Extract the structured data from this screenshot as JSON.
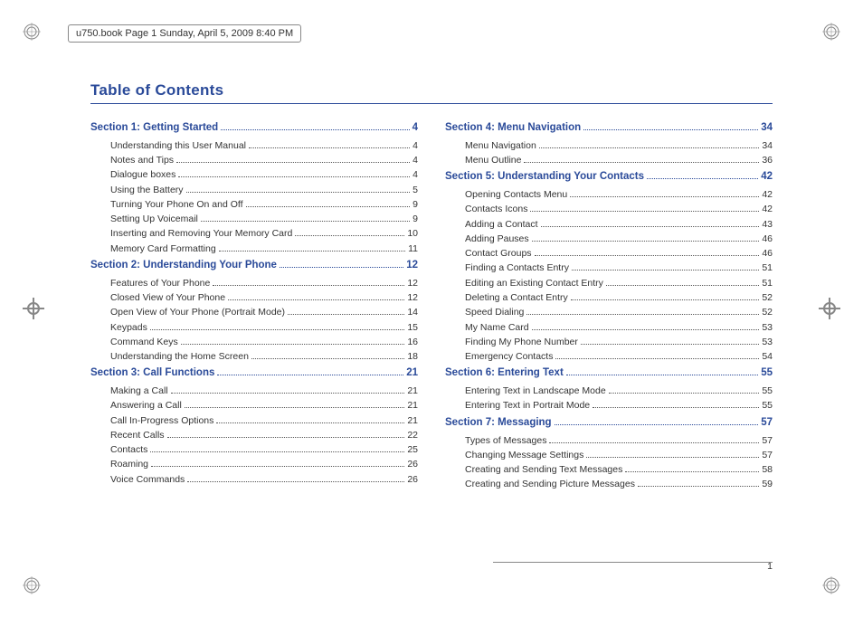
{
  "header": "u750.book  Page 1  Sunday, April 5, 2009  8:40 PM",
  "title": "Table of Contents",
  "page_number": "1",
  "left_column": [
    {
      "type": "section",
      "label": "Section 1:  Getting Started",
      "page": "4"
    },
    {
      "type": "entry",
      "label": "Understanding this User Manual",
      "page": "4"
    },
    {
      "type": "entry",
      "label": "Notes and Tips",
      "page": "4"
    },
    {
      "type": "entry",
      "label": "Dialogue boxes",
      "page": "4"
    },
    {
      "type": "entry",
      "label": "Using the Battery",
      "page": "5"
    },
    {
      "type": "entry",
      "label": "Turning Your Phone On and Off",
      "page": "9"
    },
    {
      "type": "entry",
      "label": "Setting Up Voicemail",
      "page": "9"
    },
    {
      "type": "entry",
      "label": "Inserting and Removing Your Memory Card",
      "page": "10"
    },
    {
      "type": "entry",
      "label": "Memory Card Formatting",
      "page": "11"
    },
    {
      "type": "section",
      "label": "Section 2:  Understanding Your Phone",
      "page": "12"
    },
    {
      "type": "entry",
      "label": "Features of Your Phone",
      "page": "12"
    },
    {
      "type": "entry",
      "label": "Closed View of Your Phone",
      "page": "12"
    },
    {
      "type": "entry",
      "label": "Open View of Your Phone (Portrait Mode)",
      "page": "14"
    },
    {
      "type": "entry",
      "label": "Keypads",
      "page": "15"
    },
    {
      "type": "entry",
      "label": "Command Keys",
      "page": "16"
    },
    {
      "type": "entry",
      "label": "Understanding the Home Screen",
      "page": "18"
    },
    {
      "type": "section",
      "label": "Section 3:   Call Functions",
      "page": "21"
    },
    {
      "type": "entry",
      "label": "Making a Call",
      "page": "21"
    },
    {
      "type": "entry",
      "label": "Answering a Call",
      "page": "21"
    },
    {
      "type": "entry",
      "label": "Call In-Progress Options",
      "page": "21"
    },
    {
      "type": "entry",
      "label": "Recent Calls",
      "page": "22"
    },
    {
      "type": "entry",
      "label": "Contacts",
      "page": "25"
    },
    {
      "type": "entry",
      "label": "Roaming",
      "page": "26"
    },
    {
      "type": "entry",
      "label": "Voice Commands",
      "page": "26"
    }
  ],
  "right_column": [
    {
      "type": "section",
      "label": "Section 4:   Menu Navigation",
      "page": "34"
    },
    {
      "type": "entry",
      "label": "Menu Navigation",
      "page": "34"
    },
    {
      "type": "entry",
      "label": "Menu Outline",
      "page": "36"
    },
    {
      "type": "section",
      "label": "Section 5:  Understanding Your Contacts",
      "page": "42"
    },
    {
      "type": "entry",
      "label": "Opening Contacts Menu",
      "page": "42"
    },
    {
      "type": "entry",
      "label": "Contacts Icons",
      "page": "42"
    },
    {
      "type": "entry",
      "label": "Adding a Contact",
      "page": "43"
    },
    {
      "type": "entry",
      "label": "Adding Pauses",
      "page": "46"
    },
    {
      "type": "entry",
      "label": "Contact Groups",
      "page": "46"
    },
    {
      "type": "entry",
      "label": "Finding a Contacts Entry",
      "page": "51"
    },
    {
      "type": "entry",
      "label": "Editing an Existing Contact Entry",
      "page": "51"
    },
    {
      "type": "entry",
      "label": "Deleting a Contact Entry",
      "page": "52"
    },
    {
      "type": "entry",
      "label": "Speed Dialing",
      "page": "52"
    },
    {
      "type": "entry",
      "label": "My Name Card",
      "page": "53"
    },
    {
      "type": "entry",
      "label": "Finding My Phone Number",
      "page": "53"
    },
    {
      "type": "entry",
      "label": "Emergency Contacts",
      "page": "54"
    },
    {
      "type": "section",
      "label": "Section 6:  Entering Text",
      "page": "55"
    },
    {
      "type": "entry",
      "label": "Entering Text in Landscape Mode",
      "page": "55"
    },
    {
      "type": "entry",
      "label": "Entering Text in Portrait Mode",
      "page": "55"
    },
    {
      "type": "section",
      "label": "Section 7:   Messaging",
      "page": "57"
    },
    {
      "type": "entry",
      "label": "Types of Messages",
      "page": "57"
    },
    {
      "type": "entry",
      "label": "Changing Message Settings",
      "page": "57"
    },
    {
      "type": "entry",
      "label": "Creating and Sending Text Messages",
      "page": "58"
    },
    {
      "type": "entry",
      "label": "Creating and Sending Picture Messages",
      "page": "59"
    }
  ]
}
